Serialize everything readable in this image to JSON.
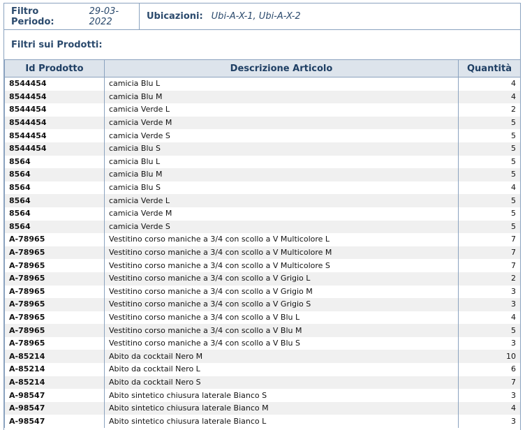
{
  "filters": {
    "period_label": "Filtro Periodo:",
    "period_value": "29-03-2022",
    "locations_label": "Ubicazioni:",
    "locations_value": "Ubi-A-X-1, Ubi-A-X-2"
  },
  "product_filter_label": "Filtri sui Prodotti:",
  "table": {
    "headers": {
      "id": "Id Prodotto",
      "desc": "Descrizione Articolo",
      "qty": "Quantità"
    },
    "rows": [
      {
        "id": "8544454",
        "desc": "camicia Blu L",
        "qty": "4"
      },
      {
        "id": "8544454",
        "desc": "camicia Blu M",
        "qty": "4"
      },
      {
        "id": "8544454",
        "desc": "camicia Verde L",
        "qty": "2"
      },
      {
        "id": "8544454",
        "desc": "camicia Verde M",
        "qty": "5"
      },
      {
        "id": "8544454",
        "desc": "camicia Verde S",
        "qty": "5"
      },
      {
        "id": "8544454",
        "desc": "camicia Blu S",
        "qty": "5"
      },
      {
        "id": "8564",
        "desc": "camicia Blu L",
        "qty": "5"
      },
      {
        "id": "8564",
        "desc": "camicia Blu M",
        "qty": "5"
      },
      {
        "id": "8564",
        "desc": "camicia Blu S",
        "qty": "4"
      },
      {
        "id": "8564",
        "desc": "camicia Verde L",
        "qty": "5"
      },
      {
        "id": "8564",
        "desc": "camicia Verde M",
        "qty": "5"
      },
      {
        "id": "8564",
        "desc": "camicia Verde S",
        "qty": "5"
      },
      {
        "id": "A-78965",
        "desc": "Vestitino corso maniche a 3/4 con scollo a V Multicolore L",
        "qty": "7"
      },
      {
        "id": "A-78965",
        "desc": "Vestitino corso maniche a 3/4 con scollo a V Multicolore M",
        "qty": "7"
      },
      {
        "id": "A-78965",
        "desc": "Vestitino corso maniche a 3/4 con scollo a V Multicolore S",
        "qty": "7"
      },
      {
        "id": "A-78965",
        "desc": "Vestitino corso maniche a 3/4 con scollo a V Grigio L",
        "qty": "2"
      },
      {
        "id": "A-78965",
        "desc": "Vestitino corso maniche a 3/4 con scollo a V Grigio M",
        "qty": "3"
      },
      {
        "id": "A-78965",
        "desc": "Vestitino corso maniche a 3/4 con scollo a V Grigio S",
        "qty": "3"
      },
      {
        "id": "A-78965",
        "desc": "Vestitino corso maniche a 3/4 con scollo a V Blu L",
        "qty": "4"
      },
      {
        "id": "A-78965",
        "desc": "Vestitino corso maniche a 3/4 con scollo a V Blu M",
        "qty": "5"
      },
      {
        "id": "A-78965",
        "desc": "Vestitino corso maniche a 3/4 con scollo a V Blu S",
        "qty": "3"
      },
      {
        "id": "A-85214",
        "desc": "Abito da cocktail Nero M",
        "qty": "10"
      },
      {
        "id": "A-85214",
        "desc": "Abito da cocktail Nero L",
        "qty": "6"
      },
      {
        "id": "A-85214",
        "desc": "Abito da cocktail Nero S",
        "qty": "7"
      },
      {
        "id": "A-98547",
        "desc": "Abito sintetico chiusura laterale Bianco S",
        "qty": "3"
      },
      {
        "id": "A-98547",
        "desc": "Abito sintetico chiusura laterale Bianco M",
        "qty": "4"
      },
      {
        "id": "A-98547",
        "desc": "Abito sintetico chiusura laterale Bianco L",
        "qty": "3"
      }
    ]
  }
}
